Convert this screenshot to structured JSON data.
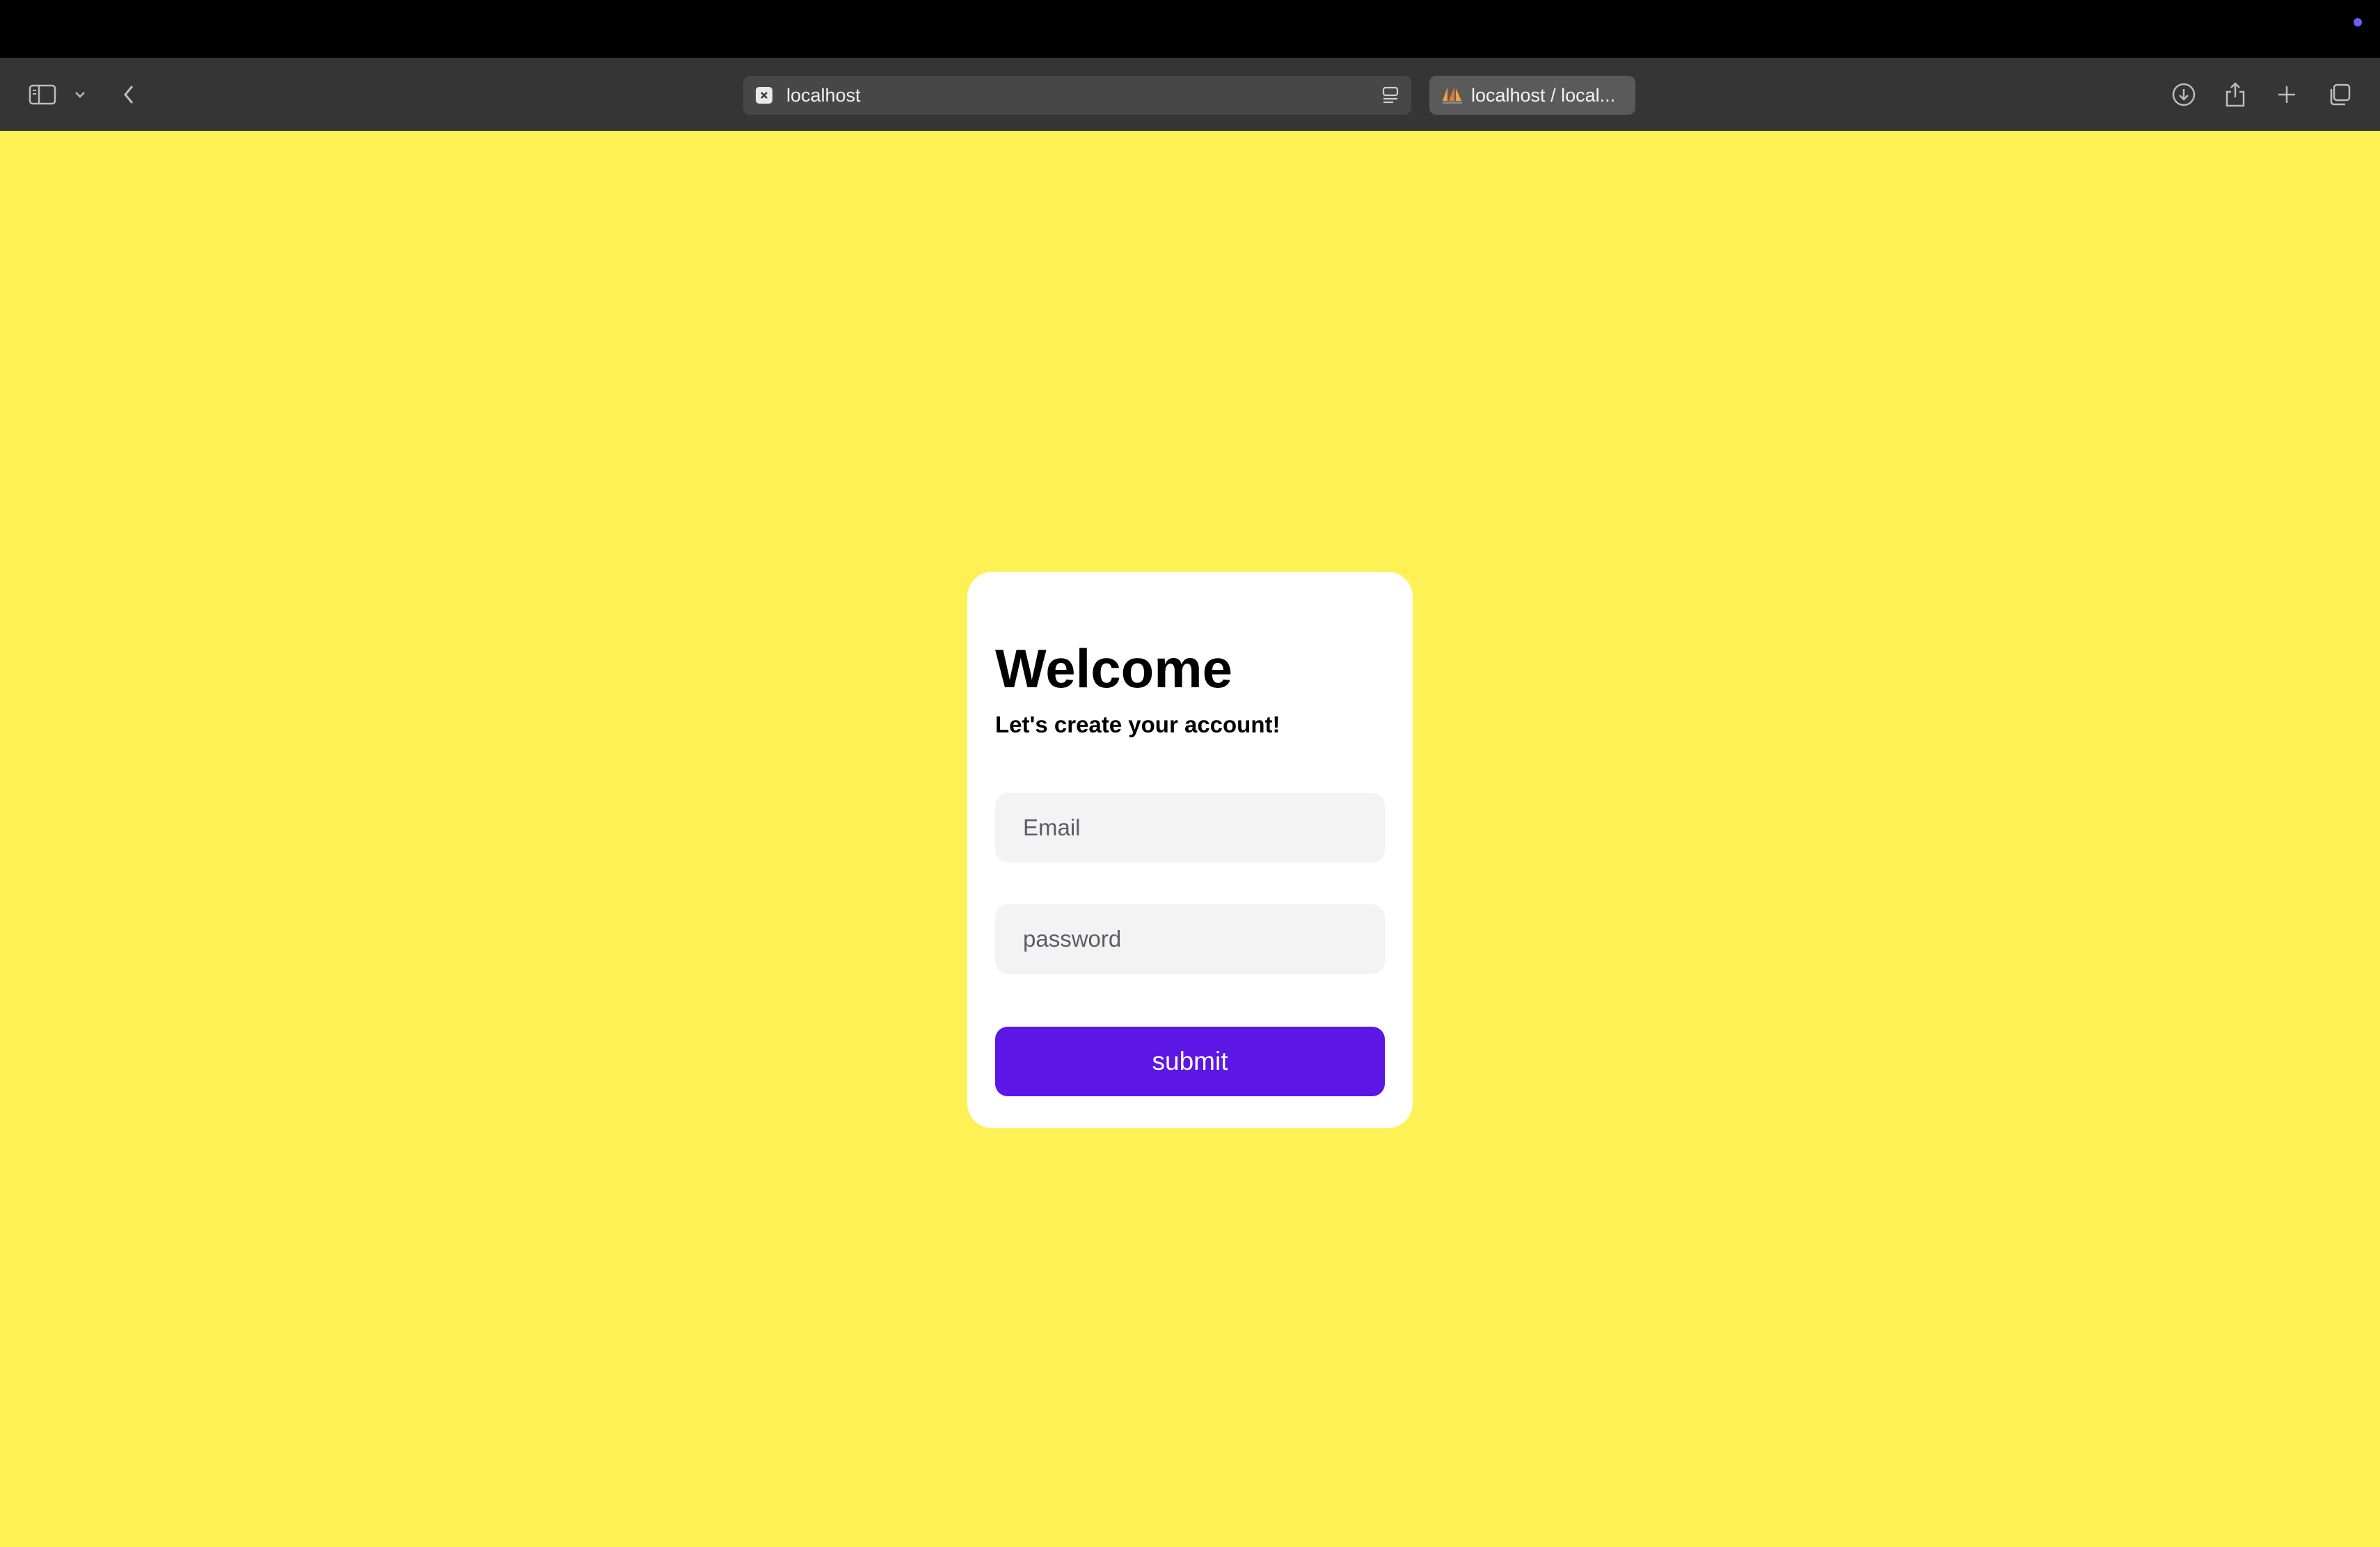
{
  "browser": {
    "address_bar": {
      "url": "localhost"
    },
    "tab": {
      "title": "localhost / local..."
    },
    "icons": [
      "sidebar-icon",
      "chevron-down-icon",
      "back-icon",
      "reader-icon",
      "download-icon",
      "share-icon",
      "new-tab-icon",
      "tab-overview-icon"
    ],
    "status_dot_color": "#6a5cff"
  },
  "page": {
    "background_color": "#fef155",
    "form": {
      "title": "Welcome",
      "subtitle": "Let's create your account!",
      "email": {
        "placeholder": "Email",
        "value": ""
      },
      "password": {
        "placeholder": "password",
        "value": ""
      },
      "submit_label": "submit",
      "submit_color": "#5c16e6"
    }
  }
}
